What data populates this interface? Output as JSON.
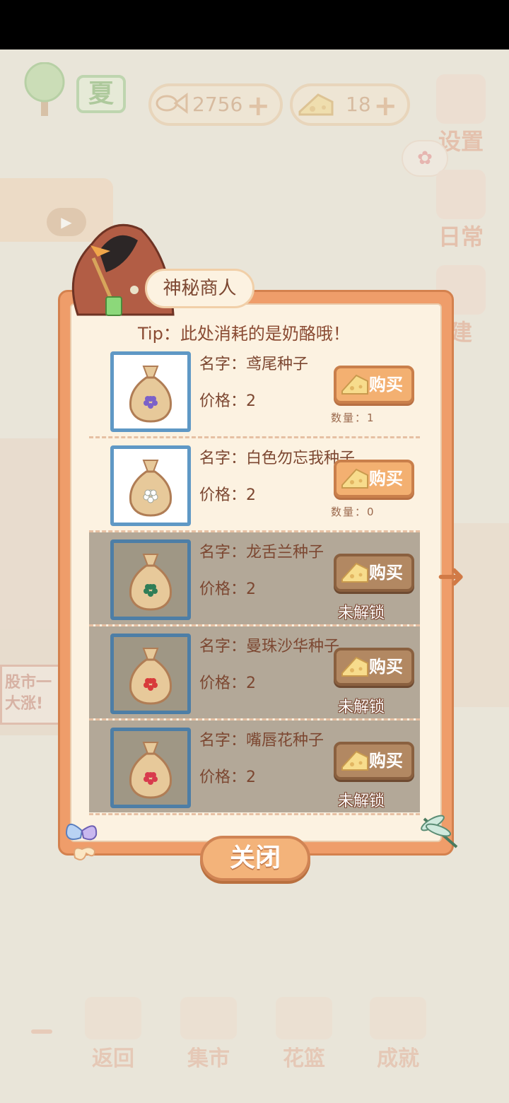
{
  "top_bar": {
    "season": "夏",
    "fish_amount": "2756",
    "cheese_amount": "18",
    "plus": "+"
  },
  "side_menu": {
    "settings": "设置",
    "daily": "日常",
    "build": "建"
  },
  "background": {
    "sign_text": "股市一大涨!"
  },
  "dialog": {
    "title": "神秘商人",
    "tip": "Tip：此处消耗的是奶酪哦！",
    "buy_label": "购买",
    "locked_label": "未解锁",
    "items": [
      {
        "name": "名字：鸢尾种子",
        "price": "价格：2",
        "quantity": "数量：1",
        "flower_color": "#7b61c9",
        "locked": false
      },
      {
        "name": "名字：白色勿忘我种子",
        "price": "价格：2",
        "quantity": "数量：0",
        "flower_color": "#ffffff",
        "locked": false
      },
      {
        "name": "名字：龙舌兰种子",
        "price": "价格：2",
        "flower_color": "#2f7d57",
        "locked": true
      },
      {
        "name": "名字：曼珠沙华种子",
        "price": "价格：2",
        "flower_color": "#d83b3b",
        "locked": true
      },
      {
        "name": "名字：嘴唇花种子",
        "price": "价格：2",
        "flower_color": "#d83b4d",
        "locked": true
      }
    ],
    "close_label": "关闭"
  },
  "bottom_nav": {
    "back": "返回",
    "market": "集市",
    "basket": "花篮",
    "achievement": "成就"
  }
}
